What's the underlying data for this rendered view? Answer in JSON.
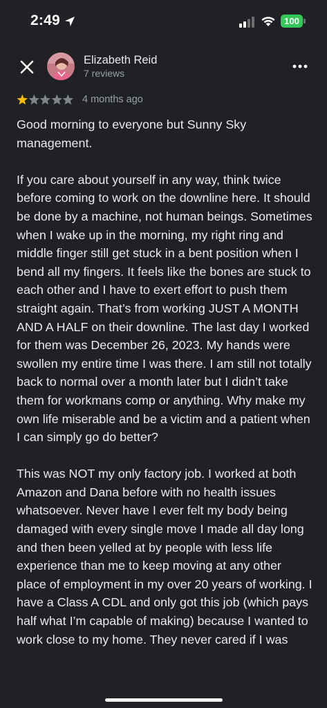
{
  "status_bar": {
    "time": "2:49",
    "battery_level": "100",
    "icons": [
      "location-arrow-icon",
      "signal-bars-icon",
      "wifi-icon",
      "battery-icon"
    ],
    "battery_color": "#34c759"
  },
  "header": {
    "close_icon": "close-icon",
    "author_name": "Elizabeth Reid",
    "author_meta": "7 reviews",
    "more_icon": "more-vert-icon"
  },
  "rating": {
    "stars": 1,
    "max_stars": 5,
    "filled_color": "#fbbc04",
    "empty_color": "#80868b",
    "date": "4 months ago"
  },
  "review": {
    "paragraphs": [
      "Good morning to everyone but Sunny Sky management.",
      "If you care about yourself in any way, think twice before coming to work on the downline here. It should be done by a machine, not human beings. Sometimes when I wake up in the morning, my right ring and middle finger still get stuck in a bent position when I bend all my fingers. It feels like the bones are stuck to each other and I have to exert effort to push them straight again. That’s from working JUST A MONTH AND A HALF on their downline. The last day I worked for them was December 26, 2023. My hands were swollen my entire time I was there. I am still not totally back to normal over a month later but I didn’t take them for workmans comp or anything. Why make my own life miserable and be a victim and a patient when I can simply go do better?",
      "This was NOT my only factory job. I worked at both Amazon and Dana before with no health issues whatsoever. Never have I ever felt my body being damaged with every single move I made all day long and then been yelled at by people with less life experience than me to keep moving at any other place of employment in my over 20 years of working. I have a Class A CDL and only got this job (which pays half what I’m capable of making) because I wanted to work close to my home. They never cared if I was"
    ]
  }
}
